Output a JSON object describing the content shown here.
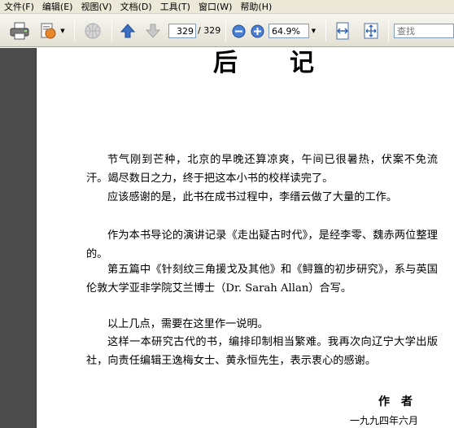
{
  "menu": [
    "文件(F)",
    "编辑(E)",
    "视图(V)",
    "文档(D)",
    "工具(T)",
    "窗口(W)",
    "帮助(H)"
  ],
  "toolbar": {
    "page_current": "329",
    "page_total": "/ 329",
    "zoom": "64.9%",
    "search_placeholder": "查找"
  },
  "document": {
    "heading_1": "后",
    "heading_2": "记",
    "paragraphs": [
      "节气刚到芒种，北京的早晚还算凉爽，午间已很暑热，伏案不免流汗。竭尽数日之力，终于把这本小书的校样读完了。",
      "应该感谢的是，此书在成书过程中，李缙云做了大量的工作。",
      "作为本书导论的演讲记录《走出疑古时代》，是经李零、魏赤两位整理的。",
      "第五篇中《针刻纹三角援戈及其他》和《鲟簋的初步研究》，系与英国伦敦大学亚非学院艾兰博士（Dr. Sarah Allan）合写。",
      "以上几点，需要在这里作一说明。",
      "这样一本研究古代的书，编排印制相当繁难。我再次向辽宁大学出版社，向责任编辑王逸梅女士、黄永恒先生，表示衷心的感谢。"
    ],
    "signature": "作者",
    "date": "一九九四年六月"
  },
  "colors": {
    "menubar_bg": "#ece9d8",
    "toolbar_bg": "#e3e0d3",
    "left_panel": "#4c4c4c",
    "accent_blue": "#3a6fc4"
  }
}
